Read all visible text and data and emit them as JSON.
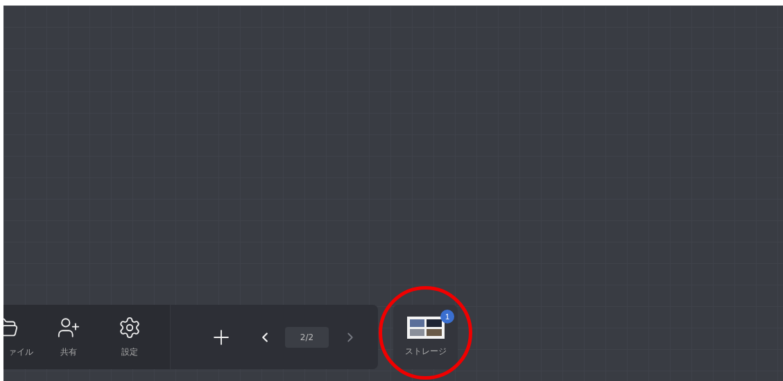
{
  "toolbar": {
    "items": [
      {
        "kind": "file",
        "label": "ァイル"
      },
      {
        "kind": "share",
        "label": "共有"
      },
      {
        "kind": "settings",
        "label": "設定"
      }
    ],
    "pager": {
      "page": "2/2",
      "prev_disabled": false,
      "next_disabled": true
    }
  },
  "storage": {
    "label": "ストレージ",
    "badge": "1",
    "highlighted": true
  }
}
